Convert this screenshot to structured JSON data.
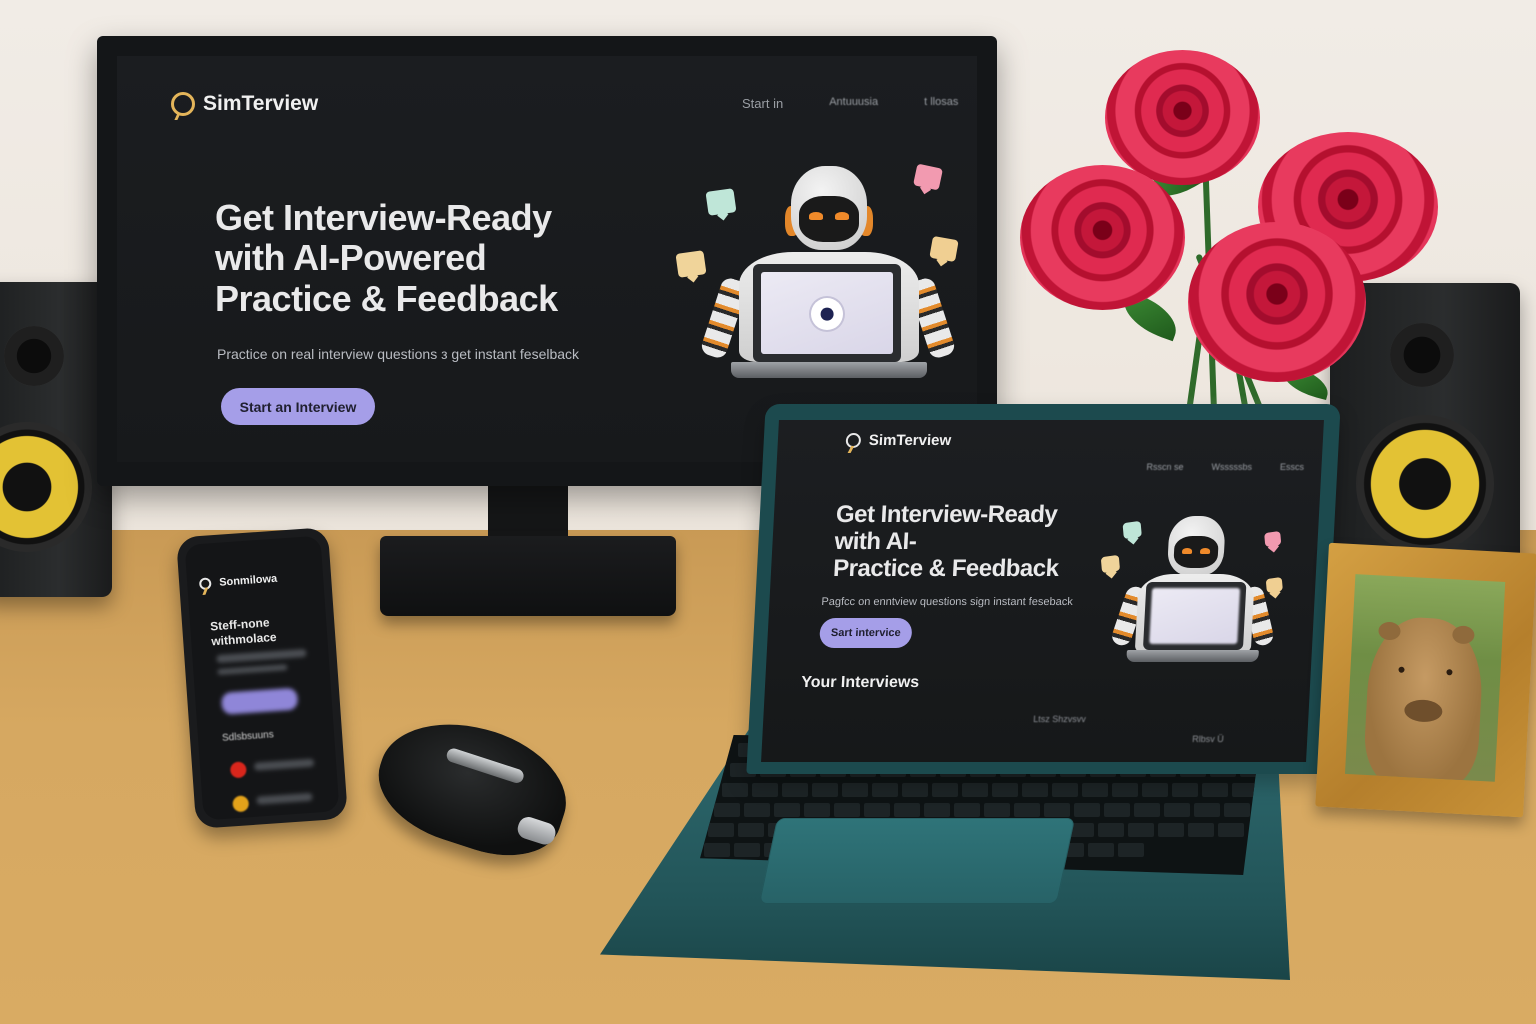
{
  "monitor": {
    "brand": "SimTerview",
    "nav": [
      "Start in",
      "Antuuusia",
      "t llosas"
    ],
    "hero_title_lines": [
      "Get Interview-Ready",
      "with AI-Powered",
      "Practice & Feedback"
    ],
    "hero_subtitle": "Practice on real interview questions з get instant feselback",
    "cta_label": "Start an Interview"
  },
  "laptop": {
    "brand": "SimTerview",
    "nav": [
      "Rsscn se",
      "Wsssssbs",
      "Esscs"
    ],
    "hero_title_lines": [
      "Get Interview-Ready",
      "with AI-",
      "Practice & Feedback"
    ],
    "hero_subtitle": "Pagfcc on enntview questions sign instant feseback",
    "cta_label": "Sart intervice",
    "section_title": "Your Interviews",
    "table_hint_left": "Ltsz Shzvsvv",
    "table_hint_right": "Rlbsv Ü"
  },
  "phone": {
    "brand": "Sonmilowa",
    "title_lines": [
      "Steff-none",
      "withmolace"
    ],
    "section_label": "Sdlsbsuuns"
  },
  "colors": {
    "accent": "#a59ee8",
    "logo": "#e4b55a",
    "screen_bg": "#17191b",
    "rose": "#e02a50",
    "desk": "#d6a861"
  }
}
